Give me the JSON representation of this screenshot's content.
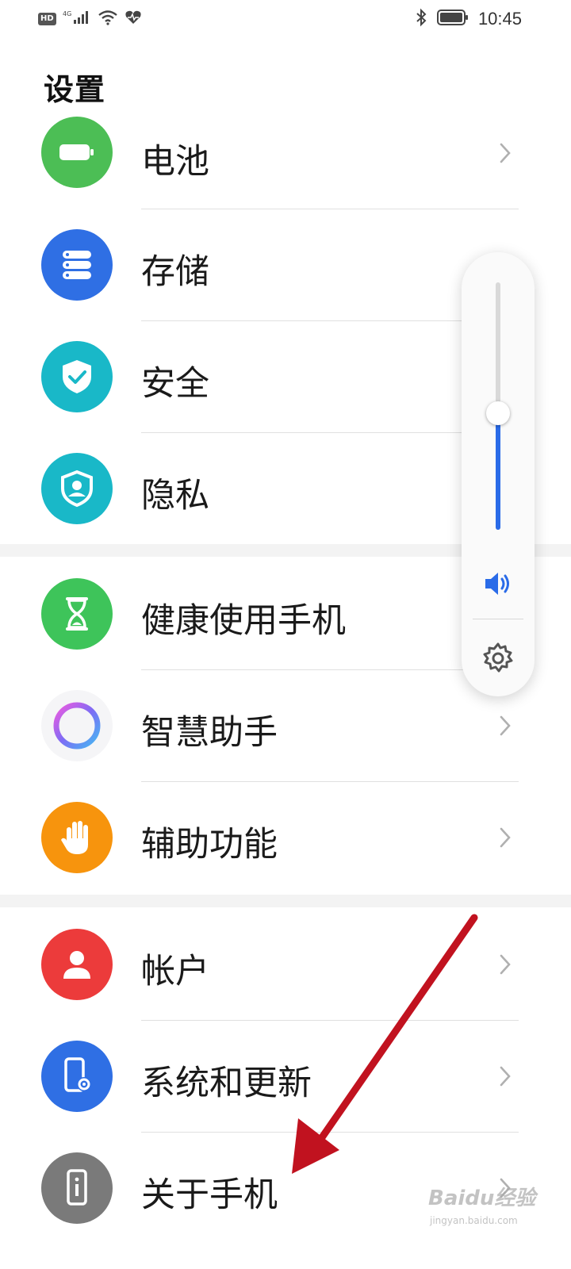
{
  "status_bar": {
    "hd": "HD",
    "network": "4G",
    "time": "10:45",
    "icons": [
      "signal-icon",
      "wifi-icon",
      "heart-icon",
      "bluetooth-icon",
      "battery-icon"
    ]
  },
  "page_title": "设置",
  "items": [
    {
      "label": "电池",
      "icon": "battery-icon",
      "color": "#4cbe55"
    },
    {
      "label": "存储",
      "icon": "storage-icon",
      "color": "#2f6fe4"
    },
    {
      "label": "安全",
      "icon": "shield-check-icon",
      "color": "#19b8c8"
    },
    {
      "label": "隐私",
      "icon": "privacy-shield-icon",
      "color": "#19b8c8"
    },
    {
      "label": "健康使用手机",
      "icon": "hourglass-icon",
      "color": "#3ec45a"
    },
    {
      "label": "智慧助手",
      "icon": "assistant-ring-icon",
      "color": "#8a6cf0"
    },
    {
      "label": "辅助功能",
      "icon": "hand-icon",
      "color": "#f7940d"
    },
    {
      "label": "帐户",
      "icon": "user-icon",
      "color": "#ec3b3b"
    },
    {
      "label": "系统和更新",
      "icon": "phone-settings-icon",
      "color": "#2f6fe4"
    },
    {
      "label": "关于手机",
      "icon": "phone-info-icon",
      "color": "#7a7a7a"
    }
  ],
  "volume_panel": {
    "level": 0.47,
    "icons": [
      "speaker-icon",
      "gear-icon"
    ],
    "accent": "#2a6be8"
  },
  "watermark": {
    "text": "Baidu经验",
    "sub": "jingyan.baidu.com"
  }
}
